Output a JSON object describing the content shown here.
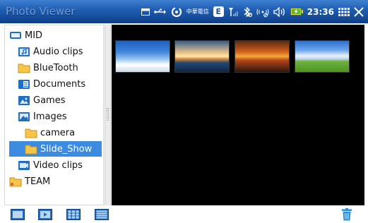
{
  "app_title": "Photo Viewer",
  "status_bar": {
    "icons": [
      "window-icon",
      "usb-icon",
      "sync-icon",
      "carrier-logo",
      "edge-icon",
      "signal-icon",
      "bluetooth-off-icon",
      "wifi-off-icon",
      "volume-icon",
      "battery-charging-icon",
      "grid-menu-icon",
      "close-icon"
    ],
    "carrier_text": "中華電信",
    "edge_label": "E",
    "time": "23:36"
  },
  "tree": {
    "root": "MID",
    "items": [
      {
        "label": "Audio clips",
        "icon": "audio-folder-icon"
      },
      {
        "label": "BlueTooth",
        "icon": "folder-icon"
      },
      {
        "label": "Documents",
        "icon": "documents-folder-icon"
      },
      {
        "label": "Games",
        "icon": "games-folder-icon"
      },
      {
        "label": "Images",
        "icon": "images-folder-icon"
      },
      {
        "label": "camera",
        "icon": "folder-icon"
      },
      {
        "label": "Slide_Show",
        "icon": "folder-icon",
        "selected": true
      },
      {
        "label": "Video clips",
        "icon": "video-folder-icon"
      }
    ],
    "team": "TEAM"
  },
  "thumbnails": [
    {
      "name": "clouds-photo"
    },
    {
      "name": "sunset-sea-photo"
    },
    {
      "name": "orange-sunset-photo"
    },
    {
      "name": "meadow-sky-photo"
    }
  ],
  "toolbar": {
    "buttons": [
      "fullscreen-view-icon",
      "slideshow-icon",
      "grid-view-icon",
      "list-view-icon"
    ],
    "right": "trash-icon"
  },
  "colors": {
    "status_bar": "#1d5bb0",
    "selection": "#3b8be0",
    "content_bg": "#000000",
    "folder": "#f6c54a",
    "toolbar_icon": "#1f6fc8",
    "trash": "#2a8fd8"
  }
}
